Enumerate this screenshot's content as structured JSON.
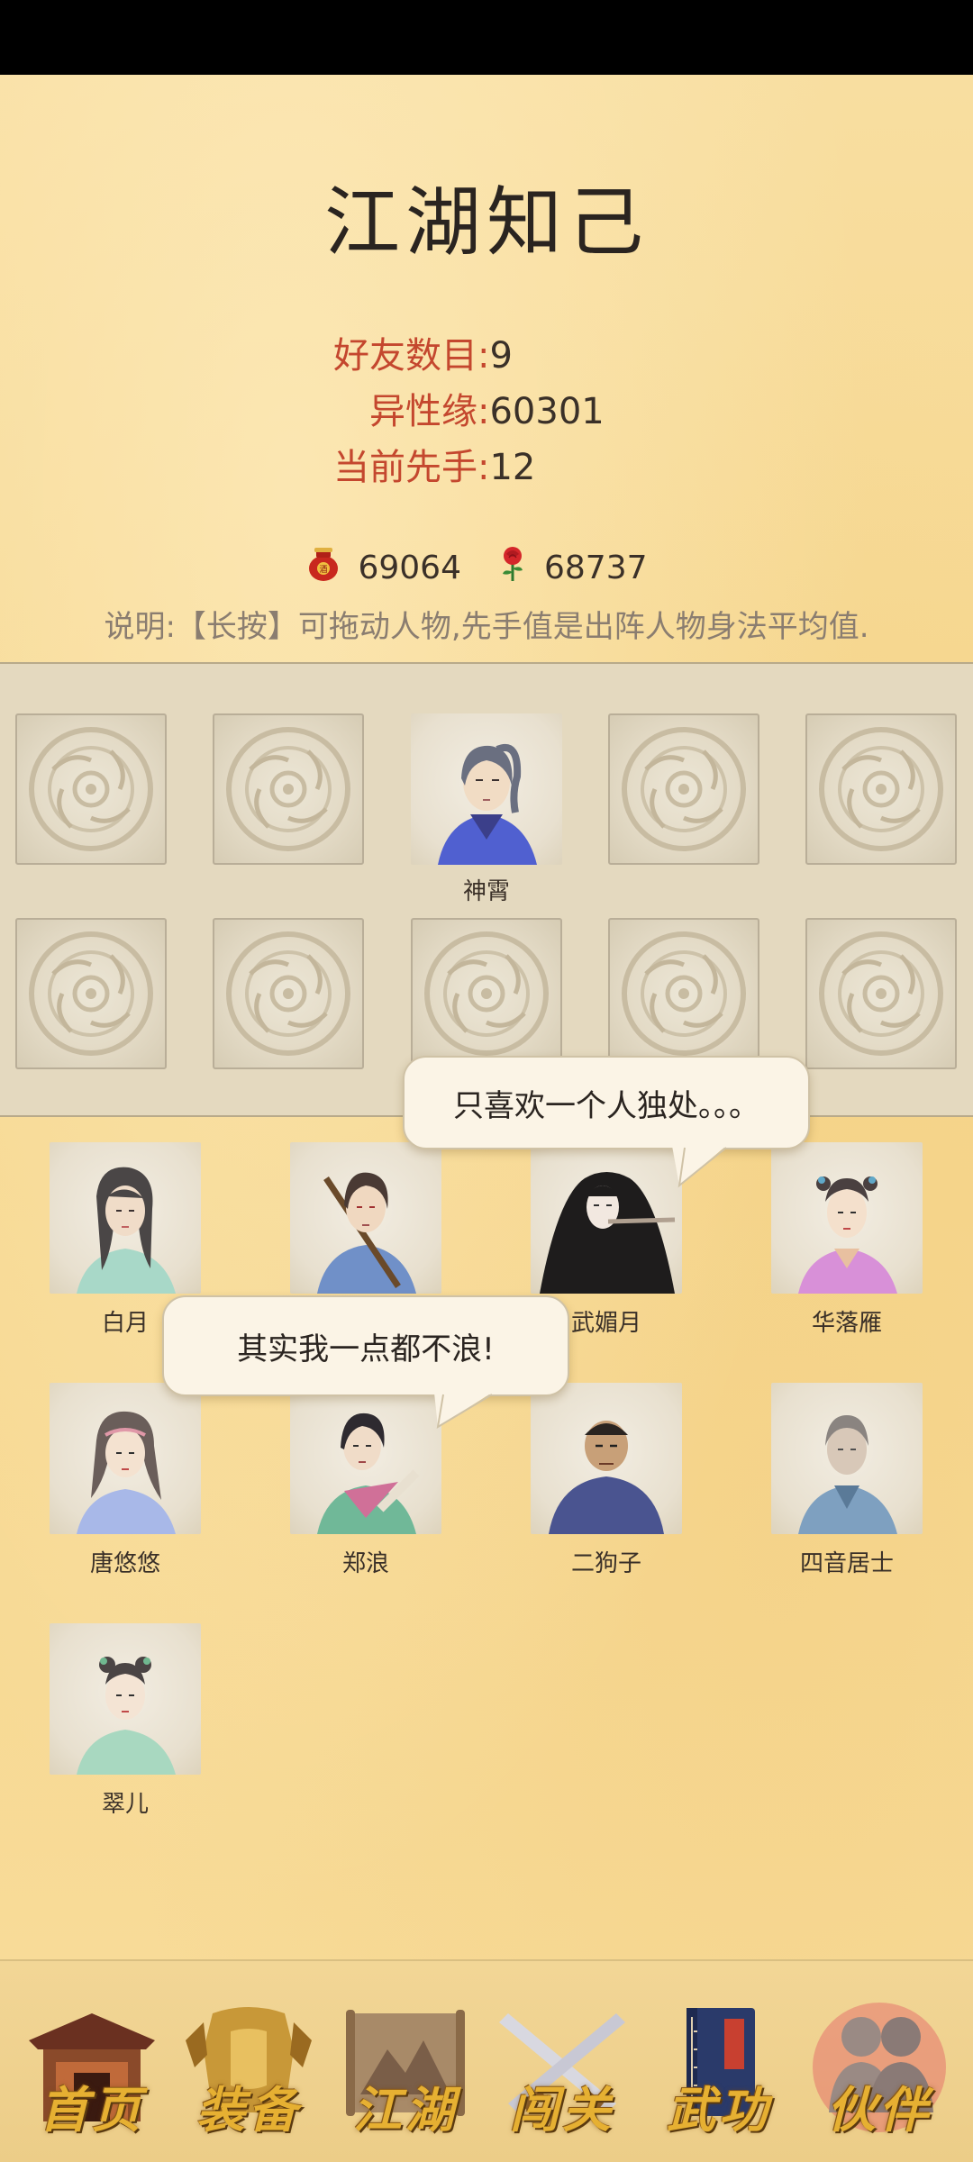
{
  "page": {
    "title": "江湖知己"
  },
  "stats": {
    "friends_label": "好友数目:",
    "friends_value": "9",
    "charm_label": "异性缘:",
    "charm_value": "60301",
    "initiative_label": "当前先手:",
    "initiative_value": "12"
  },
  "currency": {
    "wine_icon": "wine-jar-icon",
    "wine_amount": "69064",
    "rose_icon": "rose-icon",
    "rose_amount": "68737"
  },
  "notice": "说明:【长按】可拖动人物,先手值是出阵人物身法平均值.",
  "lineup": {
    "slots": [
      {
        "name": ""
      },
      {
        "name": ""
      },
      {
        "name": "神霄"
      },
      {
        "name": ""
      },
      {
        "name": ""
      },
      {
        "name": ""
      },
      {
        "name": ""
      },
      {
        "name": ""
      },
      {
        "name": ""
      },
      {
        "name": ""
      }
    ]
  },
  "roster": {
    "characters": [
      {
        "name": "白月"
      },
      {
        "name": ""
      },
      {
        "name": "武媚月"
      },
      {
        "name": "华落雁"
      },
      {
        "name": "唐悠悠"
      },
      {
        "name": "郑浪"
      },
      {
        "name": "二狗子"
      },
      {
        "name": "四音居士"
      },
      {
        "name": "翠儿"
      }
    ]
  },
  "bubbles": {
    "wu_meiyue": "只喜欢一个人独处。。。",
    "zheng_lang": "其实我一点都不浪!"
  },
  "nav": {
    "items": [
      {
        "label": "首页",
        "icon": "temple-gate-icon"
      },
      {
        "label": "装备",
        "icon": "armor-icon"
      },
      {
        "label": "江湖",
        "icon": "scroll-map-icon"
      },
      {
        "label": "闯关",
        "icon": "crossed-swords-icon"
      },
      {
        "label": "武功",
        "icon": "martial-book-icon"
      },
      {
        "label": "伙伴",
        "icon": "companions-icon"
      }
    ],
    "active": "伙伴"
  },
  "colors": {
    "label_red": "#c4472e",
    "paper": "#f7d98e",
    "lineup_panel": "#e4d9bf",
    "nav_gold": "#e6b032",
    "active_glow": "#e0405a"
  }
}
